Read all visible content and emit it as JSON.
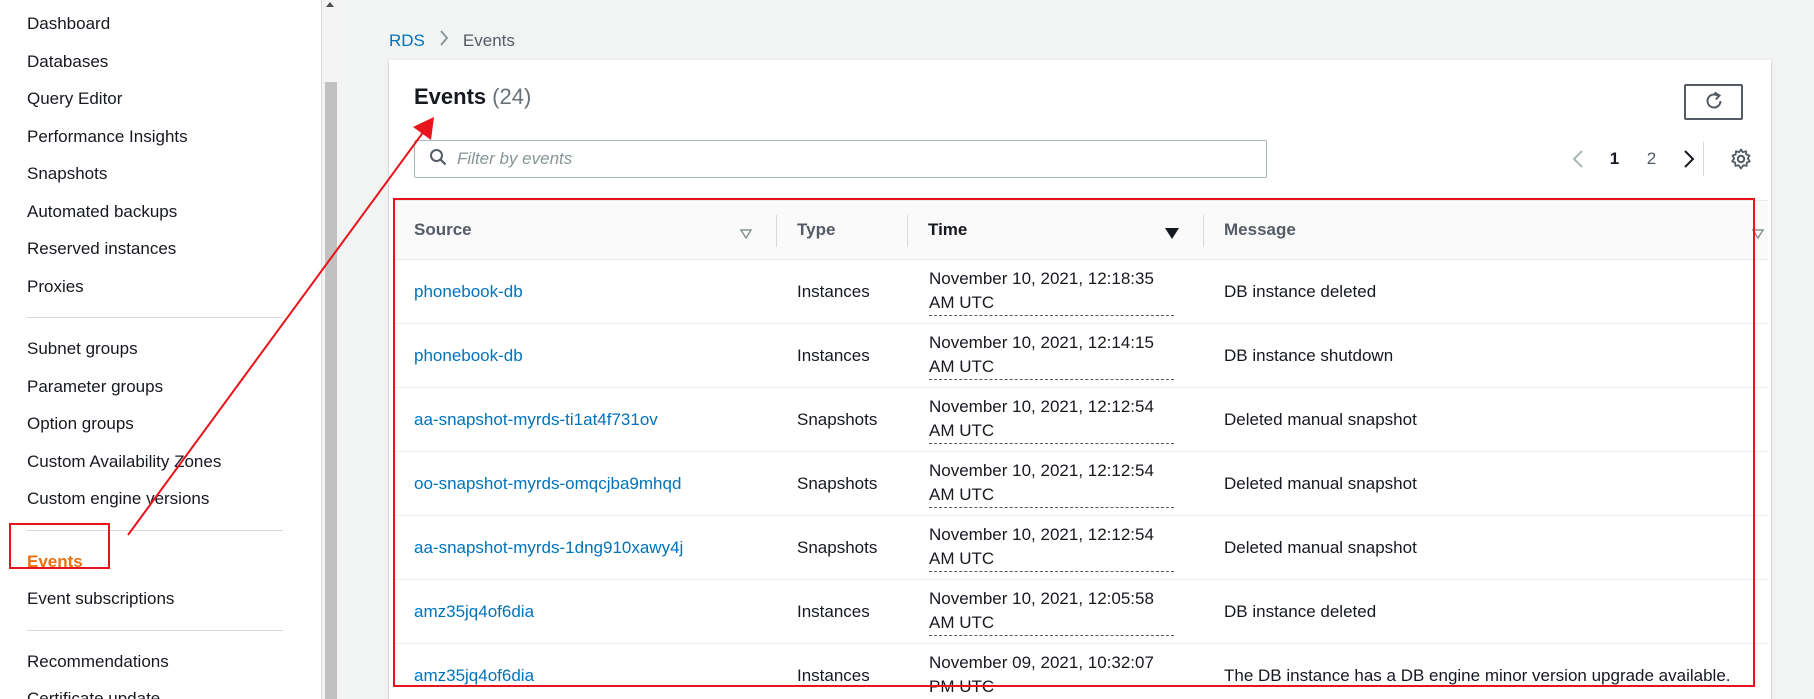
{
  "sidebar": {
    "group1": [
      "Dashboard",
      "Databases",
      "Query Editor",
      "Performance Insights",
      "Snapshots",
      "Automated backups",
      "Reserved instances",
      "Proxies"
    ],
    "group2": [
      "Subnet groups",
      "Parameter groups",
      "Option groups",
      "Custom Availability Zones",
      "Custom engine versions"
    ],
    "group3": [
      "Events",
      "Event subscriptions"
    ],
    "group4": [
      "Recommendations",
      "Certificate update"
    ],
    "active": "Events"
  },
  "breadcrumb": {
    "root": "RDS",
    "separator": ">",
    "current": "Events"
  },
  "panel": {
    "title": "Events",
    "count": "(24)",
    "filter_placeholder": "Filter by events",
    "pagination": {
      "current": "1",
      "next": "2"
    }
  },
  "table": {
    "columns": [
      "Source",
      "Type",
      "Time",
      "Message"
    ],
    "sorted_column": "Time",
    "rows": [
      {
        "source": "phonebook-db",
        "type": "Instances",
        "time_line1": "November 10, 2021, 12:18:35",
        "time_line2": "AM UTC",
        "message": "DB instance deleted"
      },
      {
        "source": "phonebook-db",
        "type": "Instances",
        "time_line1": "November 10, 2021, 12:14:15",
        "time_line2": "AM UTC",
        "message": "DB instance shutdown"
      },
      {
        "source": "aa-snapshot-myrds-ti1at4f731ov",
        "type": "Snapshots",
        "time_line1": "November 10, 2021, 12:12:54",
        "time_line2": "AM UTC",
        "message": "Deleted manual snapshot"
      },
      {
        "source": "oo-snapshot-myrds-omqcjba9mhqd",
        "type": "Snapshots",
        "time_line1": "November 10, 2021, 12:12:54",
        "time_line2": "AM UTC",
        "message": "Deleted manual snapshot"
      },
      {
        "source": "aa-snapshot-myrds-1dng910xawy4j",
        "type": "Snapshots",
        "time_line1": "November 10, 2021, 12:12:54",
        "time_line2": "AM UTC",
        "message": "Deleted manual snapshot"
      },
      {
        "source": "amz35jq4of6dia",
        "type": "Instances",
        "time_line1": "November 10, 2021, 12:05:58",
        "time_line2": "AM UTC",
        "message": "DB instance deleted"
      },
      {
        "source": "amz35jq4of6dia",
        "type": "Instances",
        "time_line1": "November 09, 2021, 10:32:07",
        "time_line2": "PM UTC",
        "message": "The DB instance has a DB engine minor version upgrade available."
      }
    ]
  },
  "colors": {
    "link": "#0073bb",
    "active_nav": "#ec7211",
    "annotation": "#e8131b"
  },
  "icons": [
    "search-icon",
    "refresh-icon",
    "chevron-left-icon",
    "chevron-right-icon",
    "gear-icon",
    "sort-icon",
    "sort-descending-icon"
  ]
}
